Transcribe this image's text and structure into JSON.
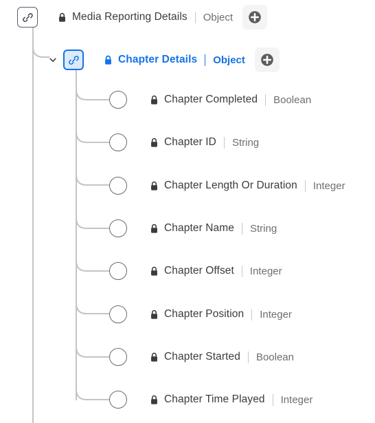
{
  "tree": {
    "root": {
      "icon": "link-icon",
      "locked": true,
      "lock_icon": "lock-icon",
      "label": "Media Reporting Details",
      "type": "Object",
      "add_button": {
        "icon": "plus-circle-icon",
        "label": ""
      }
    },
    "child_group": {
      "expand_icon": "chevron-down-icon",
      "icon": "link-icon",
      "selected": true,
      "locked": true,
      "lock_icon": "lock-icon",
      "label": "Chapter Details",
      "type": "Object",
      "add_button": {
        "icon": "plus-circle-icon",
        "label": ""
      }
    },
    "fields": [
      {
        "node_icon": "circle-node-icon",
        "lock_icon": "lock-icon",
        "label": "Chapter Completed",
        "type": "Boolean"
      },
      {
        "node_icon": "circle-node-icon",
        "lock_icon": "lock-icon",
        "label": "Chapter ID",
        "type": "String"
      },
      {
        "node_icon": "circle-node-icon",
        "lock_icon": "lock-icon",
        "label": "Chapter Length Or Duration",
        "type": "Integer"
      },
      {
        "node_icon": "circle-node-icon",
        "lock_icon": "lock-icon",
        "label": "Chapter Name",
        "type": "String"
      },
      {
        "node_icon": "circle-node-icon",
        "lock_icon": "lock-icon",
        "label": "Chapter Offset",
        "type": "Integer"
      },
      {
        "node_icon": "circle-node-icon",
        "lock_icon": "lock-icon",
        "label": "Chapter Position",
        "type": "Integer"
      },
      {
        "node_icon": "circle-node-icon",
        "lock_icon": "lock-icon",
        "label": "Chapter Started",
        "type": "Boolean"
      },
      {
        "node_icon": "circle-node-icon",
        "lock_icon": "lock-icon",
        "label": "Chapter Time Played",
        "type": "Integer"
      }
    ]
  },
  "colors": {
    "accent": "#1473E6",
    "accent_bg": "#dceafc",
    "text": "#3b3b3b",
    "muted": "#6e6e6e",
    "line": "#c4c4c4",
    "node_stroke": "#6b6b6b",
    "button_bg": "#f4f4f4",
    "plus_fill": "#5c5c5c"
  }
}
